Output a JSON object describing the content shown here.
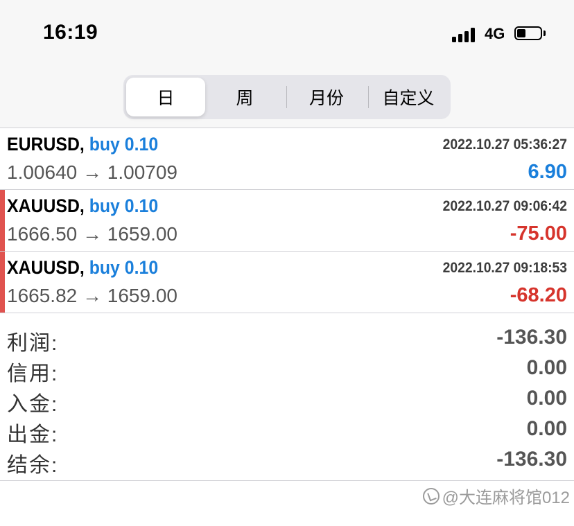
{
  "status_bar": {
    "time": "16:19",
    "network": "4G"
  },
  "tabs": [
    {
      "label": "日",
      "active": true
    },
    {
      "label": "周",
      "active": false
    },
    {
      "label": "月份",
      "active": false
    },
    {
      "label": "自定义",
      "active": false
    }
  ],
  "trades": [
    {
      "symbol": "EURUSD",
      "side": "buy",
      "volume": "0.10",
      "timestamp": "2022.10.27 05:36:27",
      "open_price": "1.00640",
      "close_price": "1.00709",
      "profit": "6.90",
      "profit_color": "#1a7fdb"
    },
    {
      "symbol": "XAUUSD",
      "side": "buy",
      "volume": "0.10",
      "timestamp": "2022.10.27 09:06:42",
      "open_price": "1666.50",
      "close_price": "1659.00",
      "profit": "-75.00",
      "profit_color": "#d6342c"
    },
    {
      "symbol": "XAUUSD",
      "side": "buy",
      "volume": "0.10",
      "timestamp": "2022.10.27 09:18:53",
      "open_price": "1665.82",
      "close_price": "1659.00",
      "profit": "-68.20",
      "profit_color": "#d6342c"
    }
  ],
  "summary": {
    "profit": {
      "label": "利润:",
      "value": "-136.30"
    },
    "credit": {
      "label": "信用:",
      "value": "0.00"
    },
    "deposit": {
      "label": "入金:",
      "value": "0.00"
    },
    "withdrawal": {
      "label": "出金:",
      "value": "0.00"
    },
    "balance": {
      "label": "结余:",
      "value": "-136.30"
    }
  },
  "watermark": "@大连麻将馆012",
  "colors": {
    "accent_blue": "#1a7fdb",
    "loss_red": "#d6342c",
    "loss_marker": "#e0534f"
  }
}
